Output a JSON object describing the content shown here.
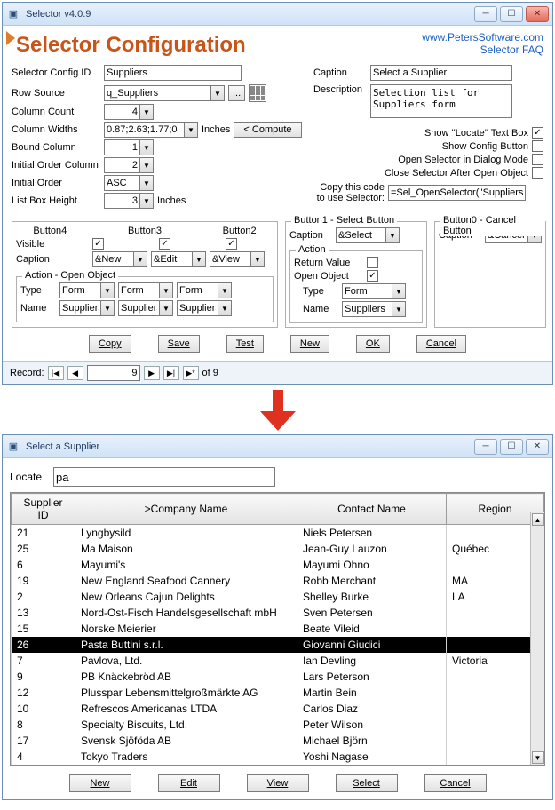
{
  "win1": {
    "title": "Selector v4.0.9",
    "big_title": "Selector Configuration",
    "link1": "www.PetersSoftware.com",
    "link2": "Selector FAQ",
    "labels": {
      "config_id": "Selector Config ID",
      "caption": "Caption",
      "description": "Description",
      "row_source": "Row Source",
      "column_count": "Column Count",
      "column_widths": "Column Widths",
      "inches": "Inches",
      "compute": "< Compute",
      "bound_column": "Bound Column",
      "initial_order_col": "Initial Order Column",
      "initial_order": "Initial Order",
      "list_box_height": "List Box Height",
      "show_locate": "Show ''Locate'' Text Box",
      "show_config": "Show Config Button",
      "open_dialog": "Open Selector in Dialog Mode",
      "close_after": "Close Selector After Open Object",
      "copy_code": "Copy this code\nto use Selector:",
      "button4": "Button4",
      "button3": "Button3",
      "button2": "Button2",
      "button1": "Button1 - Select Button",
      "button0": "Button0 - Cancel Button",
      "visible": "Visible",
      "caption_b": "Caption",
      "action_open": "Action - Open Object",
      "type": "Type",
      "name": "Name",
      "action": "Action",
      "return_value": "Return Value",
      "open_object": "Open Object"
    },
    "values": {
      "config_id": "Suppliers",
      "caption": "Select a Supplier",
      "description": "Selection list for Suppliers form",
      "row_source": "q_Suppliers",
      "column_count": "4",
      "column_widths": "0.87;2.63;1.77;0",
      "bound_column": "1",
      "initial_order_col": "2",
      "initial_order": "ASC",
      "list_box_height": "3",
      "copy_code": "=Sel_OpenSelector(''Suppliers'')",
      "btn4_caption": "&New",
      "btn3_caption": "&Edit",
      "btn2_caption": "&View",
      "btn1_caption": "&Select",
      "btn0_caption": "&Cancel",
      "type": "Form",
      "name": "Suppliers"
    },
    "checks": {
      "vis4": "✓",
      "vis3": "✓",
      "vis2": "✓",
      "show_locate": "✓",
      "show_config": "",
      "open_dialog": "",
      "close_after": "",
      "return_value": "",
      "open_object": "✓"
    },
    "toolbar": {
      "copy": "Copy",
      "save": "Save",
      "test": "Test",
      "new": "New",
      "ok": "OK",
      "cancel": "Cancel"
    },
    "recordnav": {
      "label": "Record:",
      "current": "9",
      "of": "of  9"
    }
  },
  "win2": {
    "title": "Select a Supplier",
    "locate_lbl": "Locate",
    "locate_val": "pa",
    "columns": {
      "c1": "Supplier ID",
      "c2": ">Company Name",
      "c3": "Contact Name",
      "c4": "Region"
    },
    "rows": [
      {
        "id": "21",
        "company": "Lyngbysild",
        "contact": "Niels Petersen",
        "region": ""
      },
      {
        "id": "25",
        "company": "Ma Maison",
        "contact": "Jean-Guy Lauzon",
        "region": "Québec"
      },
      {
        "id": "6",
        "company": "Mayumi's",
        "contact": "Mayumi Ohno",
        "region": ""
      },
      {
        "id": "19",
        "company": "New England Seafood Cannery",
        "contact": "Robb Merchant",
        "region": "MA"
      },
      {
        "id": "2",
        "company": "New Orleans Cajun Delights",
        "contact": "Shelley Burke",
        "region": "LA"
      },
      {
        "id": "13",
        "company": "Nord-Ost-Fisch Handelsgesellschaft mbH",
        "contact": "Sven Petersen",
        "region": ""
      },
      {
        "id": "15",
        "company": "Norske Meierier",
        "contact": "Beate Vileid",
        "region": ""
      },
      {
        "id": "26",
        "company": "Pasta Buttini s.r.l.",
        "contact": "Giovanni Giudici",
        "region": "",
        "sel": true
      },
      {
        "id": "7",
        "company": "Pavlova, Ltd.",
        "contact": "Ian Devling",
        "region": "Victoria"
      },
      {
        "id": "9",
        "company": "PB Knäckebröd AB",
        "contact": "Lars Peterson",
        "region": ""
      },
      {
        "id": "12",
        "company": "Plusspar Lebensmittelgroßmärkte AG",
        "contact": "Martin Bein",
        "region": ""
      },
      {
        "id": "10",
        "company": "Refrescos Americanas LTDA",
        "contact": "Carlos Diaz",
        "region": ""
      },
      {
        "id": "8",
        "company": "Specialty Biscuits, Ltd.",
        "contact": "Peter Wilson",
        "region": ""
      },
      {
        "id": "17",
        "company": "Svensk Sjöföda AB",
        "contact": "Michael Björn",
        "region": ""
      },
      {
        "id": "4",
        "company": "Tokyo Traders",
        "contact": "Yoshi Nagase",
        "region": ""
      }
    ],
    "buttons": {
      "new": "New",
      "edit": "Edit",
      "view": "View",
      "select": "Select",
      "cancel": "Cancel"
    }
  }
}
